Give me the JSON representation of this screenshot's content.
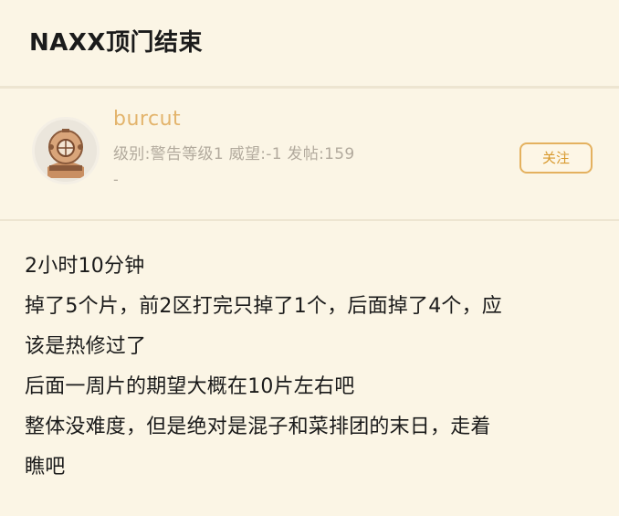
{
  "thread": {
    "title": "NAXX顶门结束"
  },
  "author": {
    "username": "burcut",
    "meta": "级别:警告等级1 威望:-1 发帖:159",
    "meta_extra": "-",
    "follow_label": "关注",
    "avatar_icon": "diver-helmet-icon"
  },
  "post": {
    "lines": [
      "2小时10分钟",
      "掉了5个片，前2区打完只掉了1个，后面掉了4个，应",
      "该是热修过了",
      "后面一周片的期望大概在10片左右吧",
      "整体没难度，但是绝对是混子和菜排团的末日，走着",
      "瞧吧"
    ]
  },
  "colors": {
    "background": "#fbf5e5",
    "username": "#e3b46c",
    "meta": "#b2aa9d",
    "accent": "#e4b15f"
  }
}
